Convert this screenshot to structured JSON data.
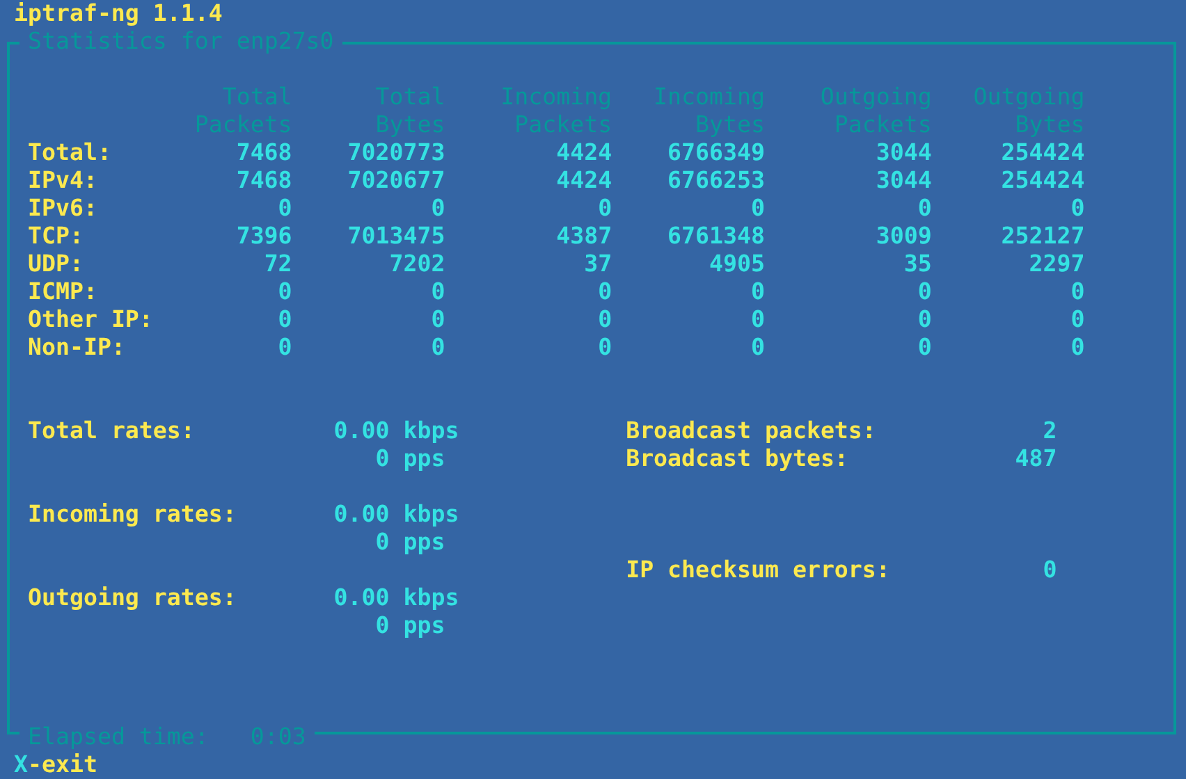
{
  "app_title": "iptraf-ng 1.1.4",
  "panel": {
    "title": "Statistics for enp27s0",
    "columns": [
      {
        "line1": "Total",
        "line2": "Packets"
      },
      {
        "line1": "Total",
        "line2": "Bytes"
      },
      {
        "line1": "Incoming",
        "line2": "Packets"
      },
      {
        "line1": "Incoming",
        "line2": "Bytes"
      },
      {
        "line1": "Outgoing",
        "line2": "Packets"
      },
      {
        "line1": "Outgoing",
        "line2": "Bytes"
      }
    ],
    "rows": [
      {
        "label": "Total:",
        "values": [
          "7468",
          "7020773",
          "4424",
          "6766349",
          "3044",
          "254424"
        ]
      },
      {
        "label": "IPv4:",
        "values": [
          "7468",
          "7020677",
          "4424",
          "6766253",
          "3044",
          "254424"
        ]
      },
      {
        "label": "IPv6:",
        "values": [
          "0",
          "0",
          "0",
          "0",
          "0",
          "0"
        ]
      },
      {
        "label": "TCP:",
        "values": [
          "7396",
          "7013475",
          "4387",
          "6761348",
          "3009",
          "252127"
        ]
      },
      {
        "label": "UDP:",
        "values": [
          "72",
          "7202",
          "37",
          "4905",
          "35",
          "2297"
        ]
      },
      {
        "label": "ICMP:",
        "values": [
          "0",
          "0",
          "0",
          "0",
          "0",
          "0"
        ]
      },
      {
        "label": "Other IP:",
        "values": [
          "0",
          "0",
          "0",
          "0",
          "0",
          "0"
        ]
      },
      {
        "label": "Non-IP:",
        "values": [
          "0",
          "0",
          "0",
          "0",
          "0",
          "0"
        ]
      }
    ],
    "rates": [
      {
        "label": "Total rates:",
        "kbps": "0.00",
        "kbps_unit": "kbps",
        "pps": "0",
        "pps_unit": "pps"
      },
      {
        "label": "Incoming rates:",
        "kbps": "0.00",
        "kbps_unit": "kbps",
        "pps": "0",
        "pps_unit": "pps"
      },
      {
        "label": "Outgoing rates:",
        "kbps": "0.00",
        "kbps_unit": "kbps",
        "pps": "0",
        "pps_unit": "pps"
      }
    ],
    "counters": [
      {
        "label": "Broadcast packets:",
        "value": "2"
      },
      {
        "label": "Broadcast bytes:",
        "value": "487"
      },
      {
        "label": "IP checksum errors:",
        "value": "0"
      }
    ],
    "elapsed": {
      "label": "Elapsed time:",
      "value": "0:03"
    }
  },
  "footer": {
    "key": "X",
    "action": "-exit"
  }
}
